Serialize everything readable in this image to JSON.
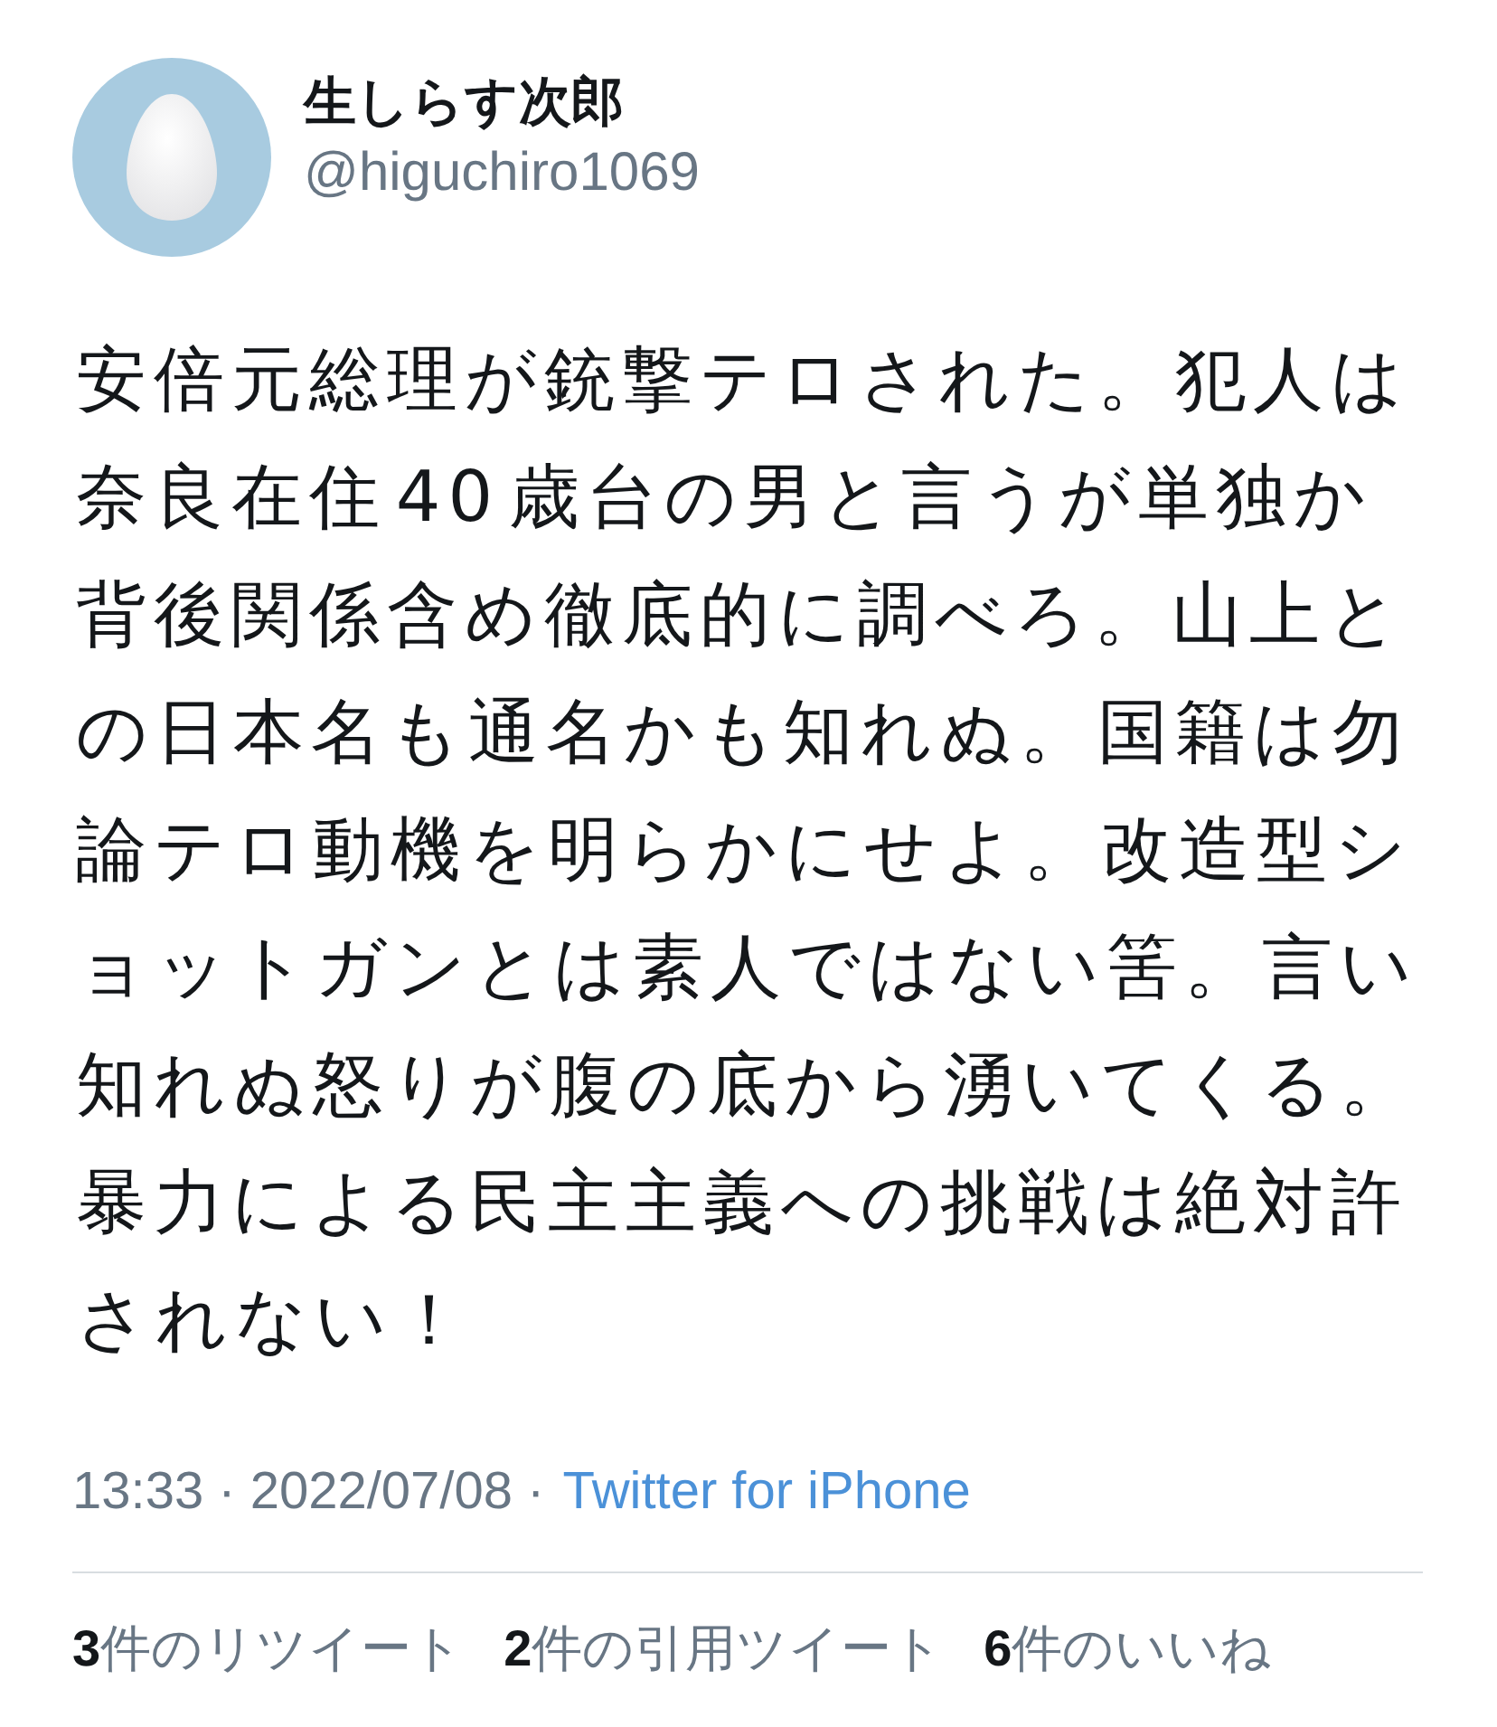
{
  "author": {
    "name": "生しらす次郎",
    "handle": "@higuchiro1069"
  },
  "tweet": {
    "text": "安倍元総理が銃撃テロされた。犯人は奈良在住40歳台の男と言うが単独か背後関係含め徹底的に調べろ。山上との日本名も通名かも知れぬ。国籍は勿論テロ動機を明らかにせよ。改造型ショットガンとは素人ではない筈。言い知れぬ怒りが腹の底から湧いてくる。暴力による民主主義への挑戦は絶対許されない！"
  },
  "meta": {
    "timestamp": "13:33 · 2022/07/08 ·",
    "source": "Twitter for iPhone"
  },
  "stats": [
    {
      "count": "3",
      "label": "件のリツイート"
    },
    {
      "count": "2",
      "label": "件の引用ツイート"
    },
    {
      "count": "6",
      "label": "件のいいね"
    }
  ]
}
